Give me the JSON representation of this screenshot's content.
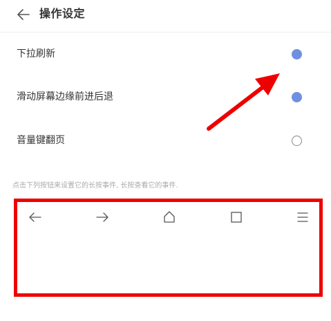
{
  "header": {
    "title": "操作设定",
    "back_icon": "arrow-left-icon"
  },
  "settings": [
    {
      "label": "下拉刷新",
      "checked": true
    },
    {
      "label": "滑动屏幕边缘前进后退",
      "checked": true
    },
    {
      "label": "音量键翻页",
      "checked": false
    }
  ],
  "hint": "点击下列按钮来设置它的长按事件, 长按查看它的事件.",
  "toolbar": {
    "buttons": [
      {
        "icon": "arrow-left-icon"
      },
      {
        "icon": "arrow-right-icon"
      },
      {
        "icon": "home-icon"
      },
      {
        "icon": "square-icon"
      },
      {
        "icon": "menu-icon"
      }
    ]
  },
  "colors": {
    "accent": "#6f8fe0",
    "annotation": "#ee0000"
  }
}
